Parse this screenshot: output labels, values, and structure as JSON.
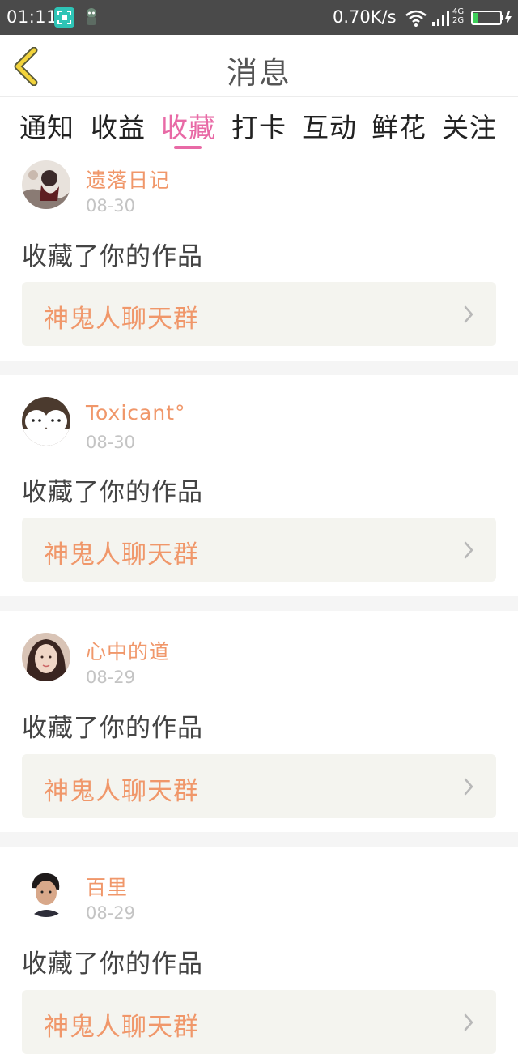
{
  "status_bar": {
    "time": "01:11",
    "speed": "0.70K/s",
    "net_top": "4G",
    "net_bottom": "2G"
  },
  "header": {
    "title": "消息"
  },
  "tabs": [
    {
      "label": "通知",
      "active": false
    },
    {
      "label": "收益",
      "active": false
    },
    {
      "label": "收藏",
      "active": true
    },
    {
      "label": "打卡",
      "active": false
    },
    {
      "label": "互动",
      "active": false
    },
    {
      "label": "鲜花",
      "active": false
    },
    {
      "label": "关注",
      "active": false
    }
  ],
  "messages": [
    {
      "username": "遗落日记",
      "date": "08-30",
      "action": "收藏了你的作品",
      "work_title": "神鬼人聊天群"
    },
    {
      "username": "Toxicant°",
      "date": "08-30",
      "action": "收藏了你的作品",
      "work_title": "神鬼人聊天群"
    },
    {
      "username": "心中的道",
      "date": "08-29",
      "action": "收藏了你的作品",
      "work_title": "神鬼人聊天群"
    },
    {
      "username": "百里",
      "date": "08-29",
      "action": "收藏了你的作品",
      "work_title": "神鬼人聊天群"
    }
  ],
  "colors": {
    "accent_pink": "#e86aa6",
    "name_orange": "#f0976a",
    "back_arrow_yellow": "#f2d33b",
    "status_bar_bg": "#4a4a4a"
  }
}
